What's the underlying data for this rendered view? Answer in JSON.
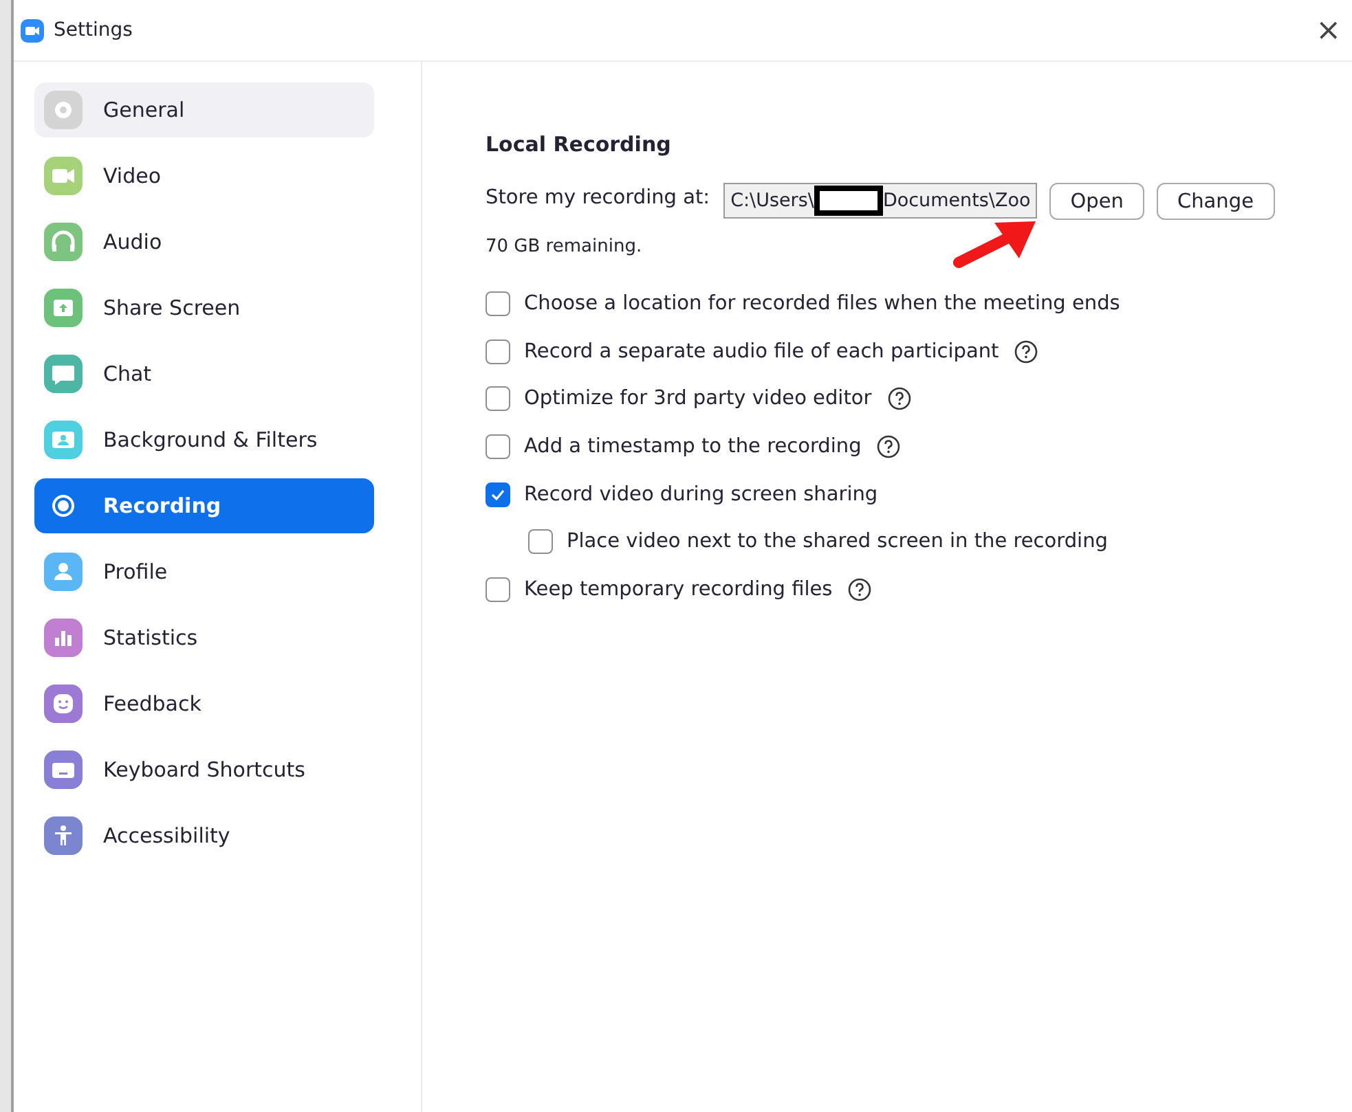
{
  "window": {
    "title": "Settings",
    "close": "×"
  },
  "sidebar": {
    "items": [
      {
        "label": "General",
        "kind": "gear",
        "color": "#d4d4d4",
        "selected": false,
        "hovered": true
      },
      {
        "label": "Video",
        "kind": "video",
        "color": "#a6d37a",
        "selected": false,
        "hovered": false
      },
      {
        "label": "Audio",
        "kind": "headphones",
        "color": "#7cc47f",
        "selected": false,
        "hovered": false
      },
      {
        "label": "Share Screen",
        "kind": "share",
        "color": "#6cc27a",
        "selected": false,
        "hovered": false
      },
      {
        "label": "Chat",
        "kind": "chat",
        "color": "#4db6a4",
        "selected": false,
        "hovered": false
      },
      {
        "label": "Background & Filters",
        "kind": "background",
        "color": "#4fd0e0",
        "selected": false,
        "hovered": false
      },
      {
        "label": "Recording",
        "kind": "record",
        "selected": true
      },
      {
        "label": "Profile",
        "kind": "profile",
        "color": "#5ab6f5",
        "selected": false,
        "hovered": false
      },
      {
        "label": "Statistics",
        "kind": "stats",
        "color": "#c07fd0",
        "selected": false,
        "hovered": false
      },
      {
        "label": "Feedback",
        "kind": "feedback",
        "color": "#9c79d4",
        "selected": false,
        "hovered": false
      },
      {
        "label": "Keyboard Shortcuts",
        "kind": "keyboard",
        "color": "#8a7fd6",
        "selected": false,
        "hovered": false
      },
      {
        "label": "Accessibility",
        "kind": "accessibility",
        "color": "#7a86cf",
        "selected": false,
        "hovered": false
      }
    ]
  },
  "local_recording": {
    "heading": "Local Recording",
    "store_label": "Store my recording at:",
    "path_field": {
      "value_start": "C:\\Users\\",
      "value_end": "Documents\\Zoo",
      "redacted": true
    },
    "buttons": [
      "Open",
      "Change"
    ],
    "remaining": "70 GB remaining."
  },
  "options": [
    {
      "label": "Choose a location for recorded files when the meeting ends",
      "checked": false,
      "help": false
    },
    {
      "label": "Record a separate audio file of each participant",
      "checked": false,
      "help": true
    },
    {
      "label": "Optimize for 3rd party video editor",
      "checked": false,
      "help": true
    },
    {
      "label": "Add a timestamp to the recording",
      "checked": false,
      "help": true
    },
    {
      "label": "Record video during screen sharing",
      "checked": true,
      "help": false,
      "children": [
        {
          "label": "Place video next to the shared screen in the recording",
          "checked": false,
          "help": false
        }
      ]
    },
    {
      "label": "Keep temporary recording files",
      "checked": false,
      "help": true
    }
  ]
}
